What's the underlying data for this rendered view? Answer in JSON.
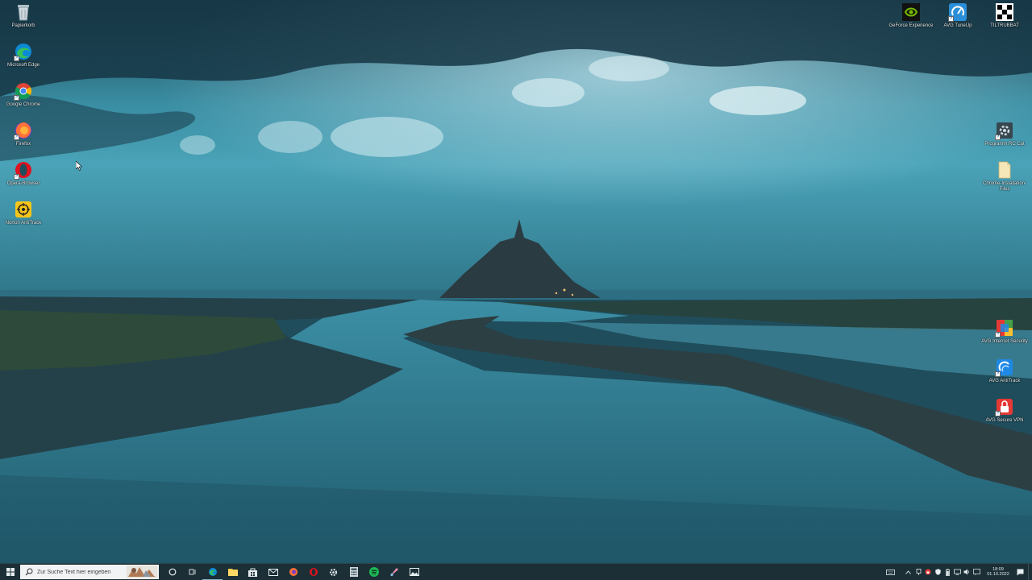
{
  "desktop": {
    "left_icons": [
      {
        "name": "recycle-bin",
        "label": "Papierkorb",
        "icon": "recycle-bin-icon"
      },
      {
        "name": "microsoft-edge",
        "label": "Microsoft Edge",
        "icon": "edge-icon"
      },
      {
        "name": "google-chrome",
        "label": "Google Chrome",
        "icon": "chrome-icon"
      },
      {
        "name": "firefox",
        "label": "Firefox",
        "icon": "firefox-icon"
      },
      {
        "name": "opera-browser",
        "label": "Opera-Browser",
        "icon": "opera-icon"
      },
      {
        "name": "norton-antitrack",
        "label": "Norton AntiTrack",
        "icon": "norton-antitrack-icon"
      }
    ],
    "right_top_icons": [
      {
        "name": "geforce-experience",
        "label": "GeForce Experience",
        "icon": "nvidia-icon"
      },
      {
        "name": "avg-tuneup",
        "label": "AVG TuneUp",
        "icon": "avg-tuneup-icon"
      },
      {
        "name": "tiltrubbat",
        "label": "TILTRUBBAT",
        "icon": "tiltrubbat-icon"
      }
    ],
    "right_icons": [
      {
        "name": "programm-rc-cat",
        "label": "Programm RC Cat",
        "icon": "gear-tool-icon"
      },
      {
        "name": "chrome-installation-files",
        "label": "Chrome-Installation-Files",
        "icon": "file-icon"
      },
      {
        "name": "avg-internet-security",
        "label": "AVG Internet Security",
        "icon": "avg-internet-security-icon"
      },
      {
        "name": "avg-antitrack",
        "label": "AVG AntiTrack",
        "icon": "avg-antitrack-icon"
      },
      {
        "name": "avg-secure-vpn",
        "label": "AVG Secure VPN",
        "icon": "vpn-lock-icon"
      }
    ]
  },
  "taskbar": {
    "search_placeholder": "Zur Suche Text hier eingeben",
    "pinned": [
      "cortana-icon",
      "task-view-icon",
      "edge-icon",
      "file-explorer-icon",
      "store-icon",
      "mail-icon",
      "firefox-icon",
      "opera-icon",
      "settings-icon",
      "calculator-icon",
      "spotify-icon",
      "paint-icon",
      "photos-icon"
    ],
    "tray_icons": [
      "keyboard-icon",
      "chevron-up-icon",
      "network-icon",
      "avg-tray-icon",
      "shield-tray-icon",
      "battery-icon",
      "wifi-icon",
      "volume-icon",
      "language-icon"
    ],
    "clock_time": "18:09",
    "clock_date": "01.10.2022"
  }
}
